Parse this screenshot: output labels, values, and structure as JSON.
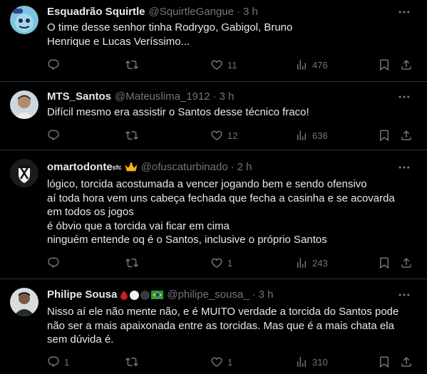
{
  "tweets": [
    {
      "name": "Esquadrão Squirtle",
      "handle": "@SquirtleGangue",
      "dot": "·",
      "time": "3 h",
      "text": "O time desse senhor tinha Rodrygo, Gabigol, Bruno\nHenrique e Lucas Veríssimo...",
      "replies": "",
      "retweets": "",
      "likes": "11",
      "views": "476"
    },
    {
      "name": "MTS_Santos",
      "handle": "@Mateuslima_1912",
      "dot": "·",
      "time": "3 h",
      "text": "Difícil mesmo era assistir o Santos desse técnico fraco!",
      "replies": "",
      "retweets": "",
      "likes": "12",
      "views": "636"
    },
    {
      "name": "omartodonte",
      "name_sup": "sfc",
      "handle": "@ofuscaturbinado",
      "dot": "·",
      "time": "2 h",
      "text": "lógico, torcida acostumada a vencer jogando bem e sendo ofensivo\naí toda hora vem uns cabeça fechada que fecha a casinha e se acovarda\nem todos os jogos\né óbvio que a torcida vai ficar em cima\nninguém entende oq é o Santos, inclusive o próprio Santos",
      "replies": "",
      "retweets": "",
      "likes": "1",
      "views": "243"
    },
    {
      "name": "Philipe Sousa",
      "handle": "@philipe_sousa_",
      "dot": "·",
      "time": "3 h",
      "text": "Nisso aí ele não mente não, e é MUITO verdade a torcida do Santos pode\nnão ser a mais apaixonada entre as torcidas. Mas que é a mais chata ela\nsem dúvida é.",
      "replies": "1",
      "retweets": "",
      "likes": "1",
      "views": "310"
    }
  ],
  "colors": {
    "background": "#000000",
    "text": "#e7e9ea",
    "muted": "#71767b",
    "divider": "#2f3336"
  },
  "icons": [
    "reply-icon",
    "retweet-icon",
    "like-icon",
    "views-icon",
    "bookmark-icon",
    "share-icon",
    "more-icon",
    "crown-icon",
    "brazil-flag-icon"
  ]
}
